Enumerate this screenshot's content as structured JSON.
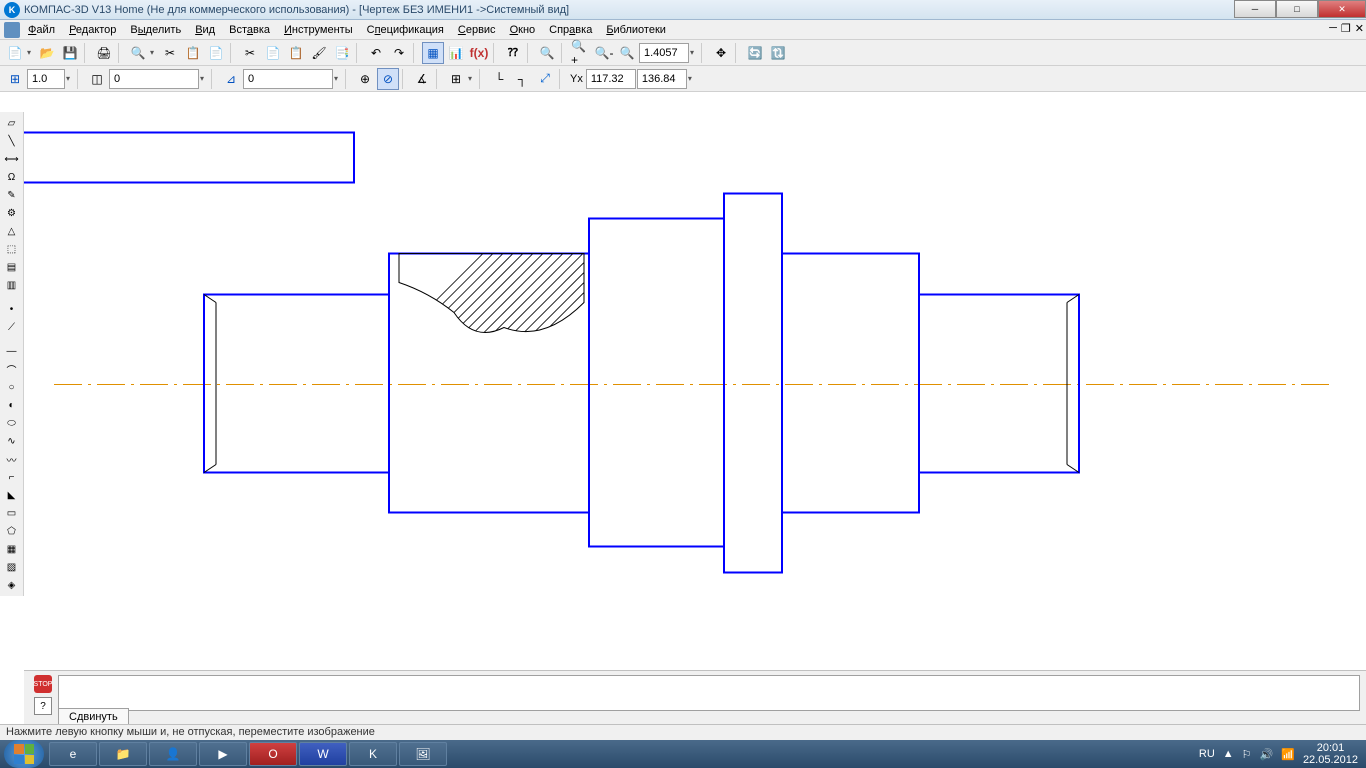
{
  "titlebar": {
    "title": "КОМПАС-3D V13 Home (Не для коммерческого использования) - [Чертеж БЕЗ ИМЕНИ1 ->Системный вид]"
  },
  "menu": {
    "file": "Файл",
    "editor": "Редактор",
    "select": "Выделить",
    "view": "Вид",
    "insert": "Вставка",
    "tools": "Инструменты",
    "spec": "Спецификация",
    "service": "Сервис",
    "window": "Окно",
    "help": "Справка",
    "library": "Библиотеки"
  },
  "toolbar1": {
    "zoom": "1.4057"
  },
  "toolbar2": {
    "step": "1.0",
    "layer": "0",
    "view": "0",
    "coord_x_label": "Yx",
    "coord_x": "117.32",
    "coord_y": "136.84"
  },
  "cmd": {
    "tab": "Сдвинуть"
  },
  "status": {
    "text": "Нажмите левую кнопку мыши и, не отпуская, переместите изображение"
  },
  "tray": {
    "lang": "RU",
    "time": "20:01",
    "date": "22.05.2012"
  }
}
